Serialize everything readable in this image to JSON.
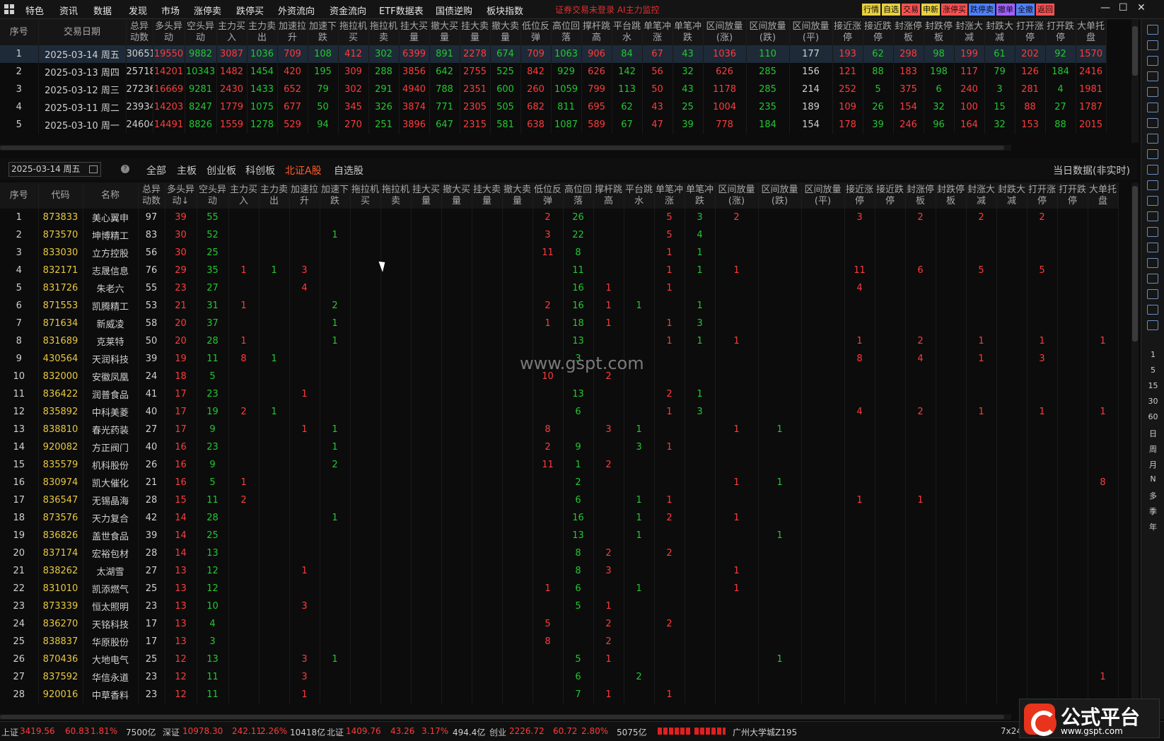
{
  "menu": [
    "特色",
    "资讯",
    "数据",
    "发现",
    "市场",
    "涨停卖",
    "跌停买",
    "外资流向",
    "资金流向",
    "ETF数据表",
    "国债逆购",
    "板块指数"
  ],
  "alert": "证券交易未登录  AI主力监控",
  "quick_buttons": [
    {
      "label": "行情",
      "color": "#e8d040"
    },
    {
      "label": "自选",
      "color": "#e8d040"
    },
    {
      "label": "交易",
      "color": "#ff5050"
    },
    {
      "label": "申新",
      "color": "#e8d040"
    },
    {
      "label": "涨停买",
      "color": "#ff5050"
    },
    {
      "label": "跌停卖",
      "color": "#5080ff"
    },
    {
      "label": "撤单",
      "color": "#a060ff"
    },
    {
      "label": "全撤",
      "color": "#5080ff"
    },
    {
      "label": "返回",
      "color": "#ff5050"
    }
  ],
  "top_headers": [
    "序号",
    "交易日期",
    "总异动数",
    "多头异动",
    "空头异动",
    "主力买入",
    "主力卖出",
    "加速拉升",
    "加速下跌",
    "拖拉机买",
    "拖拉机卖",
    "挂大买量",
    "撤大买量",
    "挂大卖量",
    "撤大卖量",
    "低位反弹",
    "高位回落",
    "撑杆跳高",
    "平台跳水",
    "单笔冲涨",
    "单笔冲跌",
    "区间放量(涨)",
    "区间放量(跌)",
    "区间放量(平)",
    "接近涨停",
    "接近跌停",
    "封涨停板",
    "封跌停板",
    "封涨大减",
    "封跌大减",
    "打开涨停",
    "打开跌停",
    "大单托盘"
  ],
  "top_rows": [
    [
      "1",
      "2025-03-14 周五",
      "30651",
      "19550",
      "9882",
      "3087",
      "1036",
      "709",
      "108",
      "412",
      "302",
      "6399",
      "891",
      "2278",
      "674",
      "709",
      "1063",
      "906",
      "84",
      "67",
      "43",
      "1036",
      "110",
      "177",
      "193",
      "62",
      "298",
      "98",
      "199",
      "61",
      "202",
      "92",
      "1570"
    ],
    [
      "2",
      "2025-03-13 周四",
      "25718",
      "14201",
      "10343",
      "1482",
      "1454",
      "420",
      "195",
      "309",
      "288",
      "3856",
      "642",
      "2755",
      "525",
      "842",
      "929",
      "626",
      "142",
      "56",
      "32",
      "626",
      "285",
      "156",
      "121",
      "88",
      "183",
      "198",
      "117",
      "79",
      "126",
      "184",
      "2416"
    ],
    [
      "3",
      "2025-03-12 周三",
      "27236",
      "16669",
      "9281",
      "2430",
      "1433",
      "652",
      "79",
      "302",
      "291",
      "4940",
      "788",
      "2351",
      "600",
      "260",
      "1059",
      "799",
      "113",
      "50",
      "43",
      "1178",
      "285",
      "214",
      "252",
      "5",
      "375",
      "6",
      "240",
      "3",
      "281",
      "4",
      "1981"
    ],
    [
      "4",
      "2025-03-11 周二",
      "23934",
      "14203",
      "8247",
      "1779",
      "1075",
      "677",
      "50",
      "345",
      "326",
      "3874",
      "771",
      "2305",
      "505",
      "682",
      "811",
      "695",
      "62",
      "43",
      "25",
      "1004",
      "235",
      "189",
      "109",
      "26",
      "154",
      "32",
      "100",
      "15",
      "88",
      "27",
      "1787"
    ],
    [
      "5",
      "2025-03-10 周一",
      "24604",
      "14491",
      "8826",
      "1559",
      "1278",
      "529",
      "94",
      "270",
      "251",
      "3896",
      "647",
      "2315",
      "581",
      "638",
      "1087",
      "589",
      "67",
      "47",
      "39",
      "778",
      "184",
      "154",
      "178",
      "39",
      "246",
      "96",
      "164",
      "32",
      "153",
      "88",
      "2015"
    ]
  ],
  "toolbar": {
    "date": "2025-03-14 周五",
    "tabs": [
      "全部",
      "主板",
      "创业板",
      "科创板",
      "北证A股",
      "自选股"
    ],
    "active": "北证A股",
    "right_text": "当日数据(非实时)"
  },
  "bottom_headers": [
    "序号",
    "代码",
    "名称",
    "总异动数",
    "多头异动↓",
    "空头异动",
    "主力买入",
    "主力卖出",
    "加速拉升",
    "加速下跌",
    "拖拉机买",
    "拖拉机卖",
    "挂大买量",
    "撤大买量",
    "挂大卖量",
    "撤大卖量",
    "低位反弹",
    "高位回落",
    "撑杆跳高",
    "平台跳水",
    "单笔冲涨",
    "单笔冲跌",
    "区间放量(涨)",
    "区间放量(跌)",
    "区间放量(平)",
    "接近涨停",
    "接近跌停",
    "封涨停板",
    "封跌停板",
    "封涨大减",
    "封跌大减",
    "打开涨停",
    "打开跌停",
    "大单托盘"
  ],
  "bottom_rows": [
    [
      "1",
      "873833",
      "美心翼申",
      "97",
      "39",
      "55",
      "",
      "",
      "",
      "",
      "",
      "",
      "",
      "",
      "",
      "",
      "2",
      "26",
      "",
      "",
      "5",
      "3",
      "2",
      "",
      "",
      "3",
      "",
      "2",
      "",
      "2",
      "",
      "2",
      "",
      ""
    ],
    [
      "2",
      "873570",
      "坤博精工",
      "83",
      "30",
      "52",
      "",
      "",
      "",
      "1",
      "",
      "",
      "",
      "",
      "",
      "",
      "3",
      "22",
      "",
      "",
      "5",
      "4",
      "",
      "",
      "",
      "",
      "",
      "",
      "",
      "",
      "",
      "",
      "",
      ""
    ],
    [
      "3",
      "833030",
      "立方控股",
      "56",
      "30",
      "25",
      "",
      "",
      "",
      "",
      "",
      "",
      "",
      "",
      "",
      "",
      "11",
      "8",
      "",
      "",
      "1",
      "1",
      "",
      "",
      "",
      "",
      "",
      "",
      "",
      "",
      "",
      "",
      "",
      ""
    ],
    [
      "4",
      "832171",
      "志晟信息",
      "76",
      "29",
      "35",
      "1",
      "1",
      "3",
      "",
      "",
      "",
      "",
      "",
      "",
      "",
      "",
      "11",
      "",
      "",
      "1",
      "1",
      "1",
      "",
      "",
      "11",
      "",
      "6",
      "",
      "5",
      "",
      "5",
      "",
      ""
    ],
    [
      "5",
      "831726",
      "朱老六",
      "55",
      "23",
      "27",
      "",
      "",
      "4",
      "",
      "",
      "",
      "",
      "",
      "",
      "",
      "",
      "16",
      "1",
      "",
      "1",
      "",
      "",
      "",
      "",
      "4",
      "",
      "",
      "",
      "",
      "",
      "",
      "",
      ""
    ],
    [
      "6",
      "871553",
      "凯腾精工",
      "53",
      "21",
      "31",
      "1",
      "",
      "",
      "2",
      "",
      "",
      "",
      "",
      "",
      "",
      "2",
      "16",
      "1",
      "1",
      "",
      "1",
      "",
      "",
      "",
      "",
      "",
      "",
      "",
      "",
      "",
      "",
      "",
      ""
    ],
    [
      "7",
      "871634",
      "新威凌",
      "58",
      "20",
      "37",
      "",
      "",
      "",
      "1",
      "",
      "",
      "",
      "",
      "",
      "",
      "1",
      "18",
      "1",
      "",
      "1",
      "3",
      "",
      "",
      "",
      "",
      "",
      "",
      "",
      "",
      "",
      "",
      "",
      ""
    ],
    [
      "8",
      "831689",
      "克莱特",
      "50",
      "20",
      "28",
      "1",
      "",
      "",
      "1",
      "",
      "",
      "",
      "",
      "",
      "",
      "",
      "13",
      "",
      "",
      "1",
      "1",
      "1",
      "",
      "",
      "1",
      "",
      "2",
      "",
      "1",
      "",
      "1",
      "",
      "1"
    ],
    [
      "9",
      "430564",
      "天润科技",
      "39",
      "19",
      "11",
      "8",
      "1",
      "",
      "",
      "",
      "",
      "",
      "",
      "",
      "",
      "",
      "3",
      "",
      "",
      "",
      "",
      "",
      "",
      "",
      "8",
      "",
      "4",
      "",
      "1",
      "",
      "3",
      "",
      ""
    ],
    [
      "10",
      "832000",
      "安徽凤凰",
      "24",
      "18",
      "5",
      "",
      "",
      "",
      "",
      "",
      "",
      "",
      "",
      "",
      "",
      "10",
      "",
      "2",
      "",
      "",
      "",
      "",
      "",
      "",
      "",
      "",
      "",
      "",
      "",
      "",
      "",
      "",
      ""
    ],
    [
      "11",
      "836422",
      "润普食品",
      "41",
      "17",
      "23",
      "",
      "",
      "1",
      "",
      "",
      "",
      "",
      "",
      "",
      "",
      "",
      "13",
      "",
      "",
      "2",
      "1",
      "",
      "",
      "",
      "",
      "",
      "",
      "",
      "",
      "",
      "",
      "",
      ""
    ],
    [
      "12",
      "835892",
      "中科美菱",
      "40",
      "17",
      "19",
      "2",
      "1",
      "",
      "",
      "",
      "",
      "",
      "",
      "",
      "",
      "",
      "6",
      "",
      "",
      "1",
      "3",
      "",
      "",
      "",
      "4",
      "",
      "2",
      "",
      "1",
      "",
      "1",
      "",
      "1"
    ],
    [
      "13",
      "838810",
      "春光药装",
      "27",
      "17",
      "9",
      "",
      "",
      "1",
      "1",
      "",
      "",
      "",
      "",
      "",
      "",
      "8",
      "",
      "3",
      "1",
      "",
      "",
      "1",
      "1",
      "",
      "",
      "",
      "",
      "",
      "",
      "",
      "",
      "",
      ""
    ],
    [
      "14",
      "920082",
      "方正阀门",
      "40",
      "16",
      "23",
      "",
      "",
      "",
      "1",
      "",
      "",
      "",
      "",
      "",
      "",
      "2",
      "9",
      "",
      "3",
      "1",
      "",
      "",
      "",
      "",
      "",
      "",
      "",
      "",
      "",
      "",
      "",
      "",
      ""
    ],
    [
      "15",
      "835579",
      "机科股份",
      "26",
      "16",
      "9",
      "",
      "",
      "",
      "2",
      "",
      "",
      "",
      "",
      "",
      "",
      "11",
      "1",
      "2",
      "",
      "",
      "",
      "",
      "",
      "",
      "",
      "",
      "",
      "",
      "",
      "",
      "",
      "",
      ""
    ],
    [
      "16",
      "830974",
      "凯大催化",
      "21",
      "16",
      "5",
      "1",
      "",
      "",
      "",
      "",
      "",
      "",
      "",
      "",
      "",
      "",
      "2",
      "",
      "",
      "",
      "",
      "1",
      "1",
      "",
      "",
      "",
      "",
      "",
      "",
      "",
      "",
      "",
      "8"
    ],
    [
      "17",
      "836547",
      "无锡晶海",
      "28",
      "15",
      "11",
      "2",
      "",
      "",
      "",
      "",
      "",
      "",
      "",
      "",
      "",
      "",
      "6",
      "",
      "1",
      "1",
      "",
      "",
      "",
      "",
      "1",
      "",
      "1",
      "",
      "",
      "",
      "",
      "",
      ""
    ],
    [
      "18",
      "873576",
      "天力复合",
      "42",
      "14",
      "28",
      "",
      "",
      "",
      "1",
      "",
      "",
      "",
      "",
      "",
      "",
      "",
      "16",
      "",
      "1",
      "2",
      "",
      "1",
      "",
      "",
      "",
      "",
      "",
      "",
      "",
      "",
      "",
      "",
      ""
    ],
    [
      "19",
      "836826",
      "盖世食品",
      "39",
      "14",
      "25",
      "",
      "",
      "",
      "",
      "",
      "",
      "",
      "",
      "",
      "",
      "",
      "13",
      "",
      "1",
      "",
      "",
      "",
      "1",
      "",
      "",
      "",
      "",
      "",
      "",
      "",
      "",
      "",
      ""
    ],
    [
      "20",
      "837174",
      "宏裕包材",
      "28",
      "14",
      "13",
      "",
      "",
      "",
      "",
      "",
      "",
      "",
      "",
      "",
      "",
      "",
      "8",
      "2",
      "",
      "2",
      "",
      "",
      "",
      "",
      "",
      "",
      "",
      "",
      "",
      "",
      "",
      "",
      ""
    ],
    [
      "21",
      "838262",
      "太湖雪",
      "27",
      "13",
      "12",
      "",
      "",
      "1",
      "",
      "",
      "",
      "",
      "",
      "",
      "",
      "",
      "8",
      "3",
      "",
      "",
      "",
      "1",
      "",
      "",
      "",
      "",
      "",
      "",
      "",
      "",
      "",
      "",
      ""
    ],
    [
      "22",
      "831010",
      "凯添燃气",
      "25",
      "13",
      "12",
      "",
      "",
      "",
      "",
      "",
      "",
      "",
      "",
      "",
      "",
      "1",
      "6",
      "",
      "1",
      "",
      "",
      "1",
      "",
      "",
      "",
      "",
      "",
      "",
      "",
      "",
      "",
      "",
      ""
    ],
    [
      "23",
      "873339",
      "恒太照明",
      "23",
      "13",
      "10",
      "",
      "",
      "3",
      "",
      "",
      "",
      "",
      "",
      "",
      "",
      "",
      "5",
      "1",
      "",
      "",
      "",
      "",
      "",
      "",
      "",
      "",
      "",
      "",
      "",
      "",
      "",
      "",
      ""
    ],
    [
      "24",
      "836270",
      "天铭科技",
      "17",
      "13",
      "4",
      "",
      "",
      "",
      "",
      "",
      "",
      "",
      "",
      "",
      "",
      "5",
      "",
      "2",
      "",
      "2",
      "",
      "",
      "",
      "",
      "",
      "",
      "",
      "",
      "",
      "",
      "",
      "",
      ""
    ],
    [
      "25",
      "838837",
      "华原股份",
      "17",
      "13",
      "3",
      "",
      "",
      "",
      "",
      "",
      "",
      "",
      "",
      "",
      "",
      "8",
      "",
      "2",
      "",
      "",
      "",
      "",
      "",
      "",
      "",
      "",
      "",
      "",
      "",
      "",
      "",
      "",
      ""
    ],
    [
      "26",
      "870436",
      "大地电气",
      "25",
      "12",
      "13",
      "",
      "",
      "3",
      "1",
      "",
      "",
      "",
      "",
      "",
      "",
      "",
      "5",
      "1",
      "",
      "",
      "",
      "",
      "1",
      "",
      "",
      "",
      "",
      "",
      "",
      "",
      "",
      "",
      ""
    ],
    [
      "27",
      "837592",
      "华信永道",
      "23",
      "12",
      "11",
      "",
      "",
      "3",
      "",
      "",
      "",
      "",
      "",
      "",
      "",
      "",
      "6",
      "",
      "2",
      "",
      "",
      "",
      "",
      "",
      "",
      "",
      "",
      "",
      "",
      "",
      "",
      "",
      "1"
    ],
    [
      "28",
      "920016",
      "中草香料",
      "23",
      "12",
      "11",
      "",
      "",
      "1",
      "",
      "",
      "",
      "",
      "",
      "",
      "",
      "",
      "7",
      "1",
      "",
      "1",
      "",
      "",
      "",
      "",
      "",
      "",
      "",
      "",
      "",
      "",
      "",
      "",
      ""
    ]
  ],
  "sidebar_labels": [
    "1",
    "5",
    "15",
    "30",
    "60",
    "日",
    "周",
    "月",
    "N",
    "多",
    "季",
    "年"
  ],
  "status": {
    "sh_label": "上证",
    "sh_val": "3419.56",
    "sh_chg": "60.83",
    "sh_pct": "1.81%",
    "sh_amt": "7500亿",
    "sz_label": "深证",
    "sz_val": "10978.30",
    "sz_chg": "242.11",
    "sz_pct": "2.26%",
    "sz_amt": "10418亿",
    "bz_label": "北证",
    "bz_val": "1409.76",
    "bz_chg": "43.26",
    "bz_pct": "3.17%",
    "bz_amt": "494.4亿",
    "cy_label": "创业",
    "cy_val": "2226.72",
    "cy_chg": "60.72",
    "cy_pct": "2.80%",
    "cy_amt": "5075亿",
    "location": "广州大学城Z195",
    "right": "7x24"
  },
  "watermark": "www.gspt.com",
  "logo": {
    "title": "公式平台",
    "url": "www.gspt.com"
  }
}
